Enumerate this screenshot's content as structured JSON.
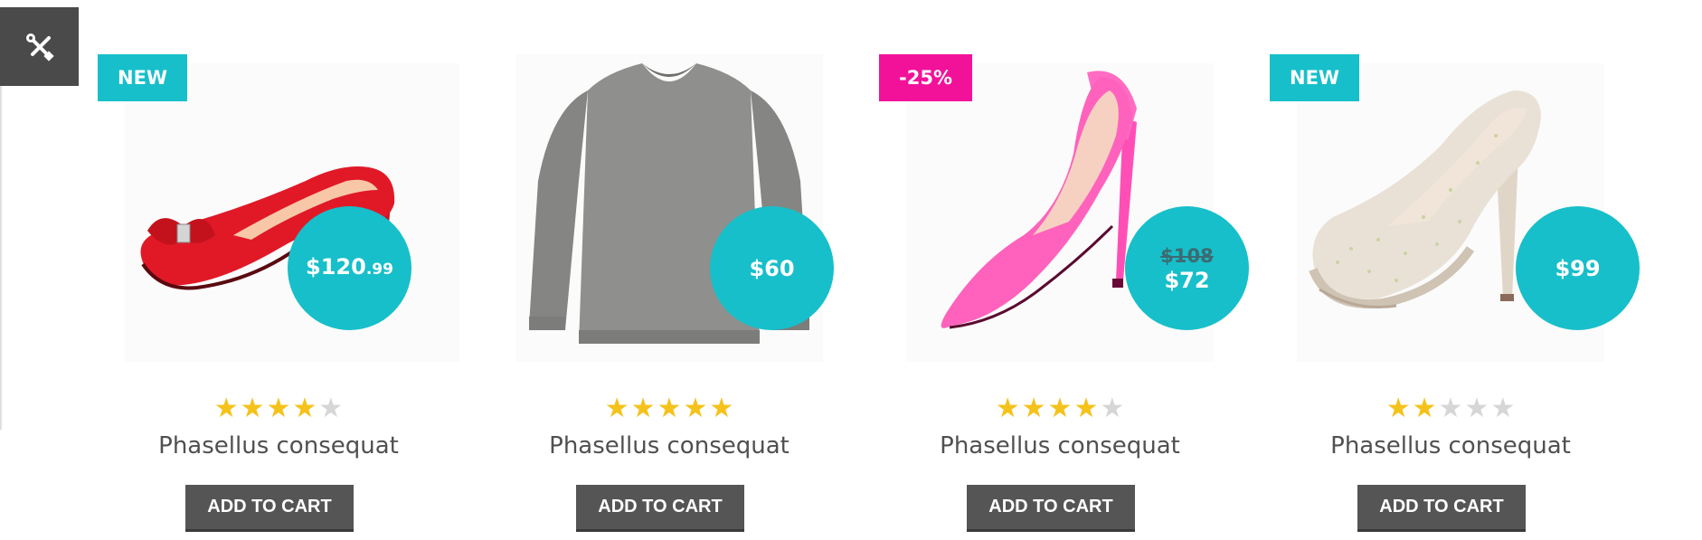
{
  "theme": {
    "accent": "#17bfca",
    "sale_badge": "#f2129a",
    "star_on": "#f5c21b",
    "star_off": "#d6d6d6",
    "button_bg": "#555555"
  },
  "toolbar": {
    "icon": "tools-icon"
  },
  "products": [
    {
      "badge": "NEW",
      "badge_type": "new",
      "price": "$120",
      "price_cents": ".99",
      "old_price": "",
      "rating": 4,
      "title": "Phasellus consequat",
      "button": "ADD TO CART",
      "image": "red-suede-pump"
    },
    {
      "badge": "",
      "badge_type": "none",
      "price": "$60",
      "price_cents": "",
      "old_price": "",
      "rating": 5,
      "title": "Phasellus consequat",
      "button": "ADD TO CART",
      "image": "grey-sweater"
    },
    {
      "badge": "-25%",
      "badge_type": "sale",
      "price": "$72",
      "price_cents": "",
      "old_price": "$108",
      "rating": 4,
      "title": "Phasellus consequat",
      "button": "ADD TO CART",
      "image": "pink-patent-stiletto"
    },
    {
      "badge": "NEW",
      "badge_type": "new",
      "price": "$99",
      "price_cents": "",
      "old_price": "",
      "rating": 2,
      "title": "Phasellus consequat",
      "button": "ADD TO CART",
      "image": "rhinestone-platform-heel"
    }
  ]
}
